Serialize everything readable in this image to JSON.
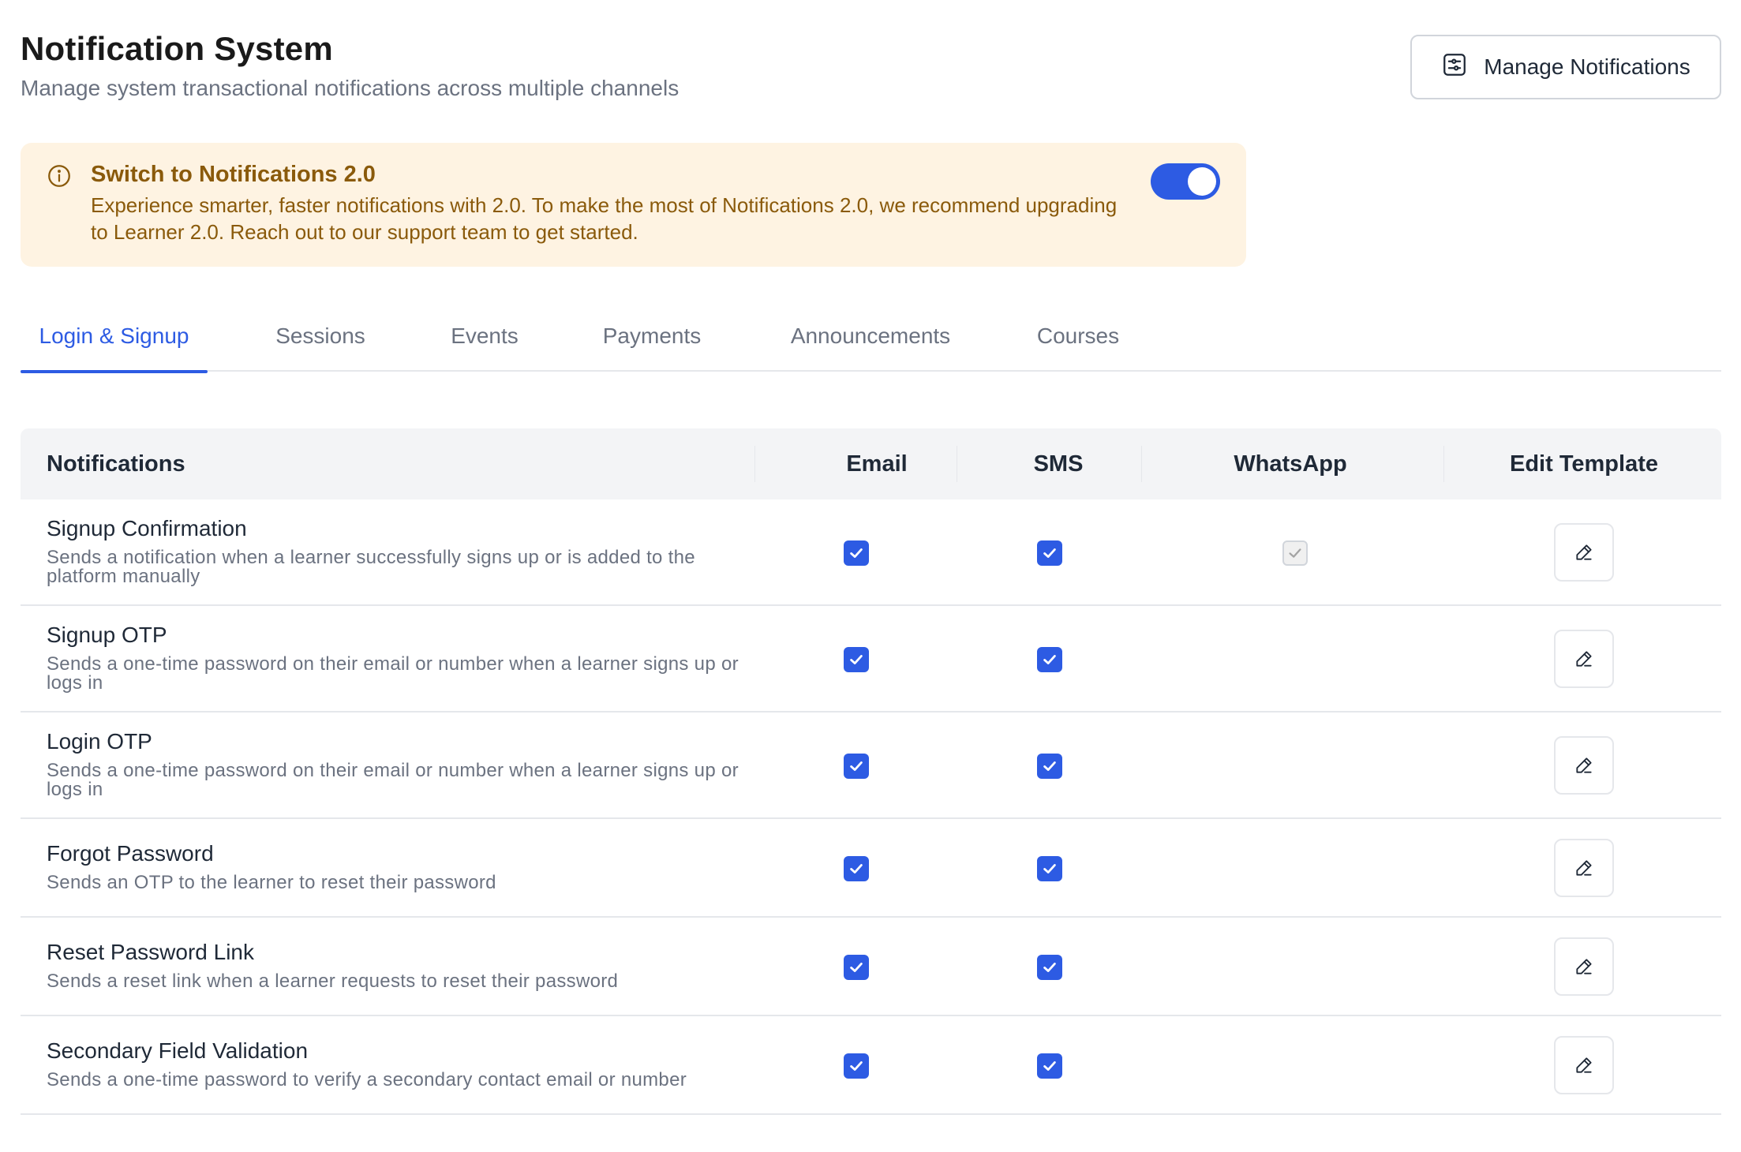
{
  "header": {
    "title": "Notification System",
    "subtitle": "Manage system transactional notifications across multiple channels",
    "manage_button": "Manage Notifications"
  },
  "banner": {
    "title": "Switch to Notifications 2.0",
    "text": "Experience smarter, faster notifications with 2.0. To make the most of Notifications 2.0, we recommend upgrading to Learner 2.0. Reach out to our support team to get started.",
    "toggle_on": true
  },
  "tabs": [
    {
      "label": "Login & Signup",
      "active": true
    },
    {
      "label": "Sessions",
      "active": false
    },
    {
      "label": "Events",
      "active": false
    },
    {
      "label": "Payments",
      "active": false
    },
    {
      "label": "Announcements",
      "active": false
    },
    {
      "label": "Courses",
      "active": false
    }
  ],
  "table": {
    "columns": [
      "Notifications",
      "Email",
      "SMS",
      "WhatsApp",
      "Edit Template"
    ],
    "rows": [
      {
        "title": "Signup Confirmation",
        "description": "Sends a notification when a learner successfully signs up or is added to the platform manually",
        "email": true,
        "sms": true,
        "whatsapp": "checked-disabled"
      },
      {
        "title": "Signup OTP",
        "description": "Sends a one-time password on their email or number when a learner signs up or logs in",
        "email": true,
        "sms": true,
        "whatsapp": null
      },
      {
        "title": "Login OTP",
        "description": "Sends a one-time password on their email or number when a learner signs up or logs in",
        "email": true,
        "sms": true,
        "whatsapp": null
      },
      {
        "title": "Forgot Password",
        "description": "Sends an OTP to the learner to reset their password",
        "email": true,
        "sms": true,
        "whatsapp": null
      },
      {
        "title": "Reset Password Link",
        "description": "Sends a reset link when a learner requests to reset their password",
        "email": true,
        "sms": true,
        "whatsapp": null
      },
      {
        "title": "Secondary Field Validation",
        "description": "Sends a one-time password to verify a secondary contact email or number",
        "email": true,
        "sms": true,
        "whatsapp": null
      }
    ]
  },
  "colors": {
    "accent": "#2d5be3",
    "banner_bg": "#fef3e2",
    "banner_text": "#8a5a0b"
  },
  "icons": {
    "manage": "sliders-settings-icon",
    "banner": "info-circle-icon",
    "checkbox": "checkmark-icon",
    "edit": "pencil-icon"
  }
}
